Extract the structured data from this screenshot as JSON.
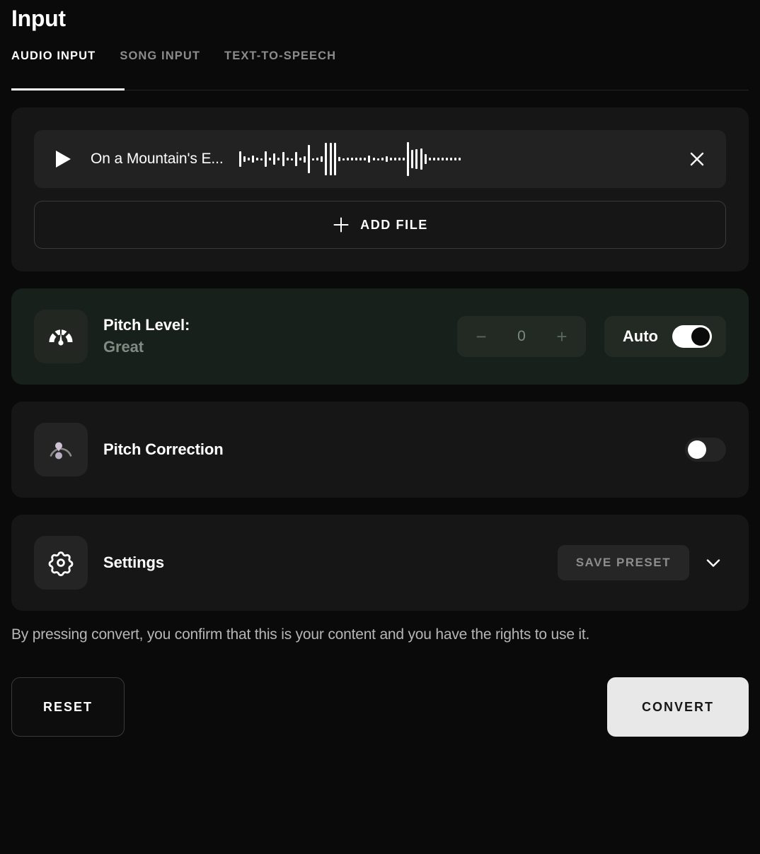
{
  "header": {
    "title": "Input",
    "tabs": [
      {
        "label": "AUDIO INPUT",
        "active": true
      },
      {
        "label": "SONG INPUT",
        "active": false
      },
      {
        "label": "TEXT-TO-SPEECH",
        "active": false
      }
    ]
  },
  "file_card": {
    "file": {
      "name": "On a Mountain's E...",
      "play_icon": "play-icon",
      "remove_icon": "close-icon",
      "waveform": [
        22,
        8,
        4,
        10,
        4,
        3,
        22,
        4,
        16,
        4,
        20,
        4,
        3,
        20,
        4,
        9,
        40,
        3,
        4,
        8,
        46,
        46,
        46,
        6,
        3,
        4,
        4,
        4,
        4,
        4,
        10,
        4,
        3,
        4,
        8,
        4,
        4,
        4,
        4,
        48,
        26,
        28,
        30,
        14,
        4,
        4,
        4,
        4,
        4,
        4,
        4,
        4
      ]
    },
    "add_file": {
      "label": "ADD FILE",
      "icon": "plus-icon"
    }
  },
  "pitch_level": {
    "icon": "gauge-icon",
    "title": "Pitch Level:",
    "status": "Great",
    "stepper": {
      "decrement_label": "−",
      "value": "0",
      "increment_label": "+"
    },
    "auto": {
      "label": "Auto",
      "state": "on"
    }
  },
  "pitch_correction": {
    "icon": "pitch-correction-icon",
    "title": "Pitch Correction",
    "toggle_state": "off"
  },
  "settings": {
    "icon": "gear-icon",
    "title": "Settings",
    "save_preset_label": "SAVE PRESET",
    "expand_icon": "chevron-down-icon"
  },
  "disclaimer": "By pressing convert, you confirm that this is your content and you have the rights to use it.",
  "footer": {
    "reset_label": "RESET",
    "convert_label": "CONVERT"
  },
  "colors": {
    "page_bg": "#0a0a0a",
    "card_bg": "#161616",
    "pitch_card_bg": "#18201b",
    "accent_white": "#ffffff",
    "muted_text": "#8b8d8c",
    "convert_bg": "#e8e8e8"
  }
}
